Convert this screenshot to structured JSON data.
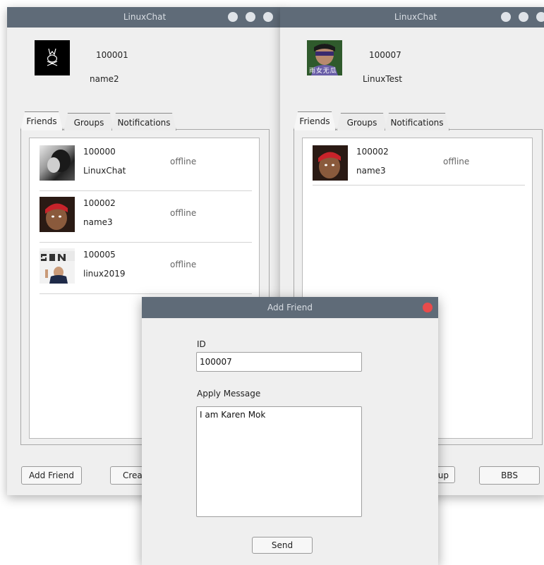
{
  "window_left": {
    "title": "LinuxChat",
    "user": {
      "id": "100001",
      "name": "name2"
    },
    "tabs": [
      "Friends",
      "Groups",
      "Notifications"
    ],
    "friends": [
      {
        "id": "100000",
        "name": "LinuxChat",
        "status": "offline",
        "avatar": "bw-portrait"
      },
      {
        "id": "100002",
        "name": "name3",
        "status": "offline",
        "avatar": "red-bandana-face"
      },
      {
        "id": "100005",
        "name": "linux2019",
        "status": "offline",
        "avatar": "sony-presenter"
      }
    ],
    "buttons": {
      "add_friend": "Add Friend",
      "create_partial": "Creat"
    }
  },
  "window_right": {
    "title": "LinuxChat",
    "user": {
      "id": "100007",
      "name": "LinuxTest",
      "avatar_caption": "雨 女 无 瓜"
    },
    "tabs": [
      "Friends",
      "Groups",
      "Notifications"
    ],
    "friends": [
      {
        "id": "100002",
        "name": "name3",
        "status": "offline",
        "avatar": "red-bandana-face"
      }
    ],
    "buttons": {
      "group_partial": "up",
      "bbs": "BBS"
    }
  },
  "dialog": {
    "title": "Add Friend",
    "id_label": "ID",
    "id_value": "100007",
    "message_label": "Apply Message",
    "message_value": "I am Karen Mok",
    "send": "Send"
  },
  "colors": {
    "titlebar": "#5f6b78",
    "close": "#e94b4b",
    "window_bg": "#efefef"
  }
}
